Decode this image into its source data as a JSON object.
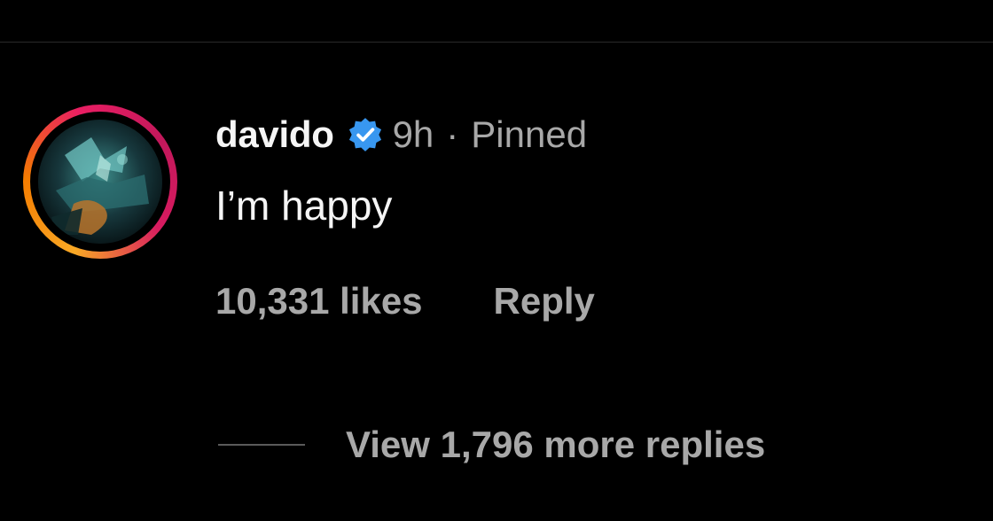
{
  "comment": {
    "username": "davido",
    "verified": true,
    "time": "9h",
    "separator": "·",
    "pinned_label": "Pinned",
    "text": "I’m happy",
    "likes_label": "10,331 likes",
    "reply_label": "Reply",
    "view_replies_label": "View 1,796 more replies",
    "avatar_icon": "avatar-image",
    "verified_icon": "verified-badge-icon"
  },
  "colors": {
    "background": "#000000",
    "primary_text": "#f5f5f5",
    "secondary_text": "#a8a8a8",
    "verified_blue": "#3897f0",
    "story_ring_start": "#f9a825",
    "story_ring_end": "#e91e63"
  }
}
